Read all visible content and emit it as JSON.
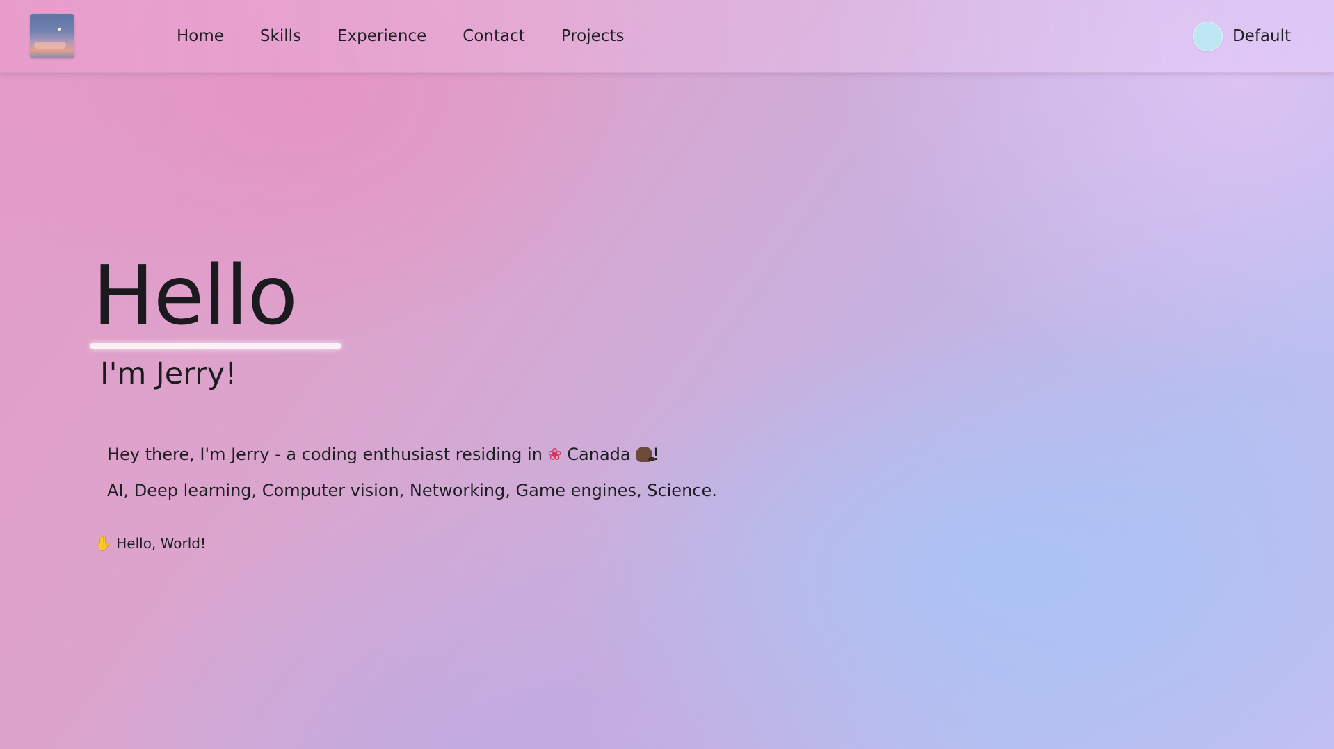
{
  "navbar": {
    "logo_icon": "sunset-sky-logo-icon",
    "links": [
      {
        "label": "Home"
      },
      {
        "label": "Skills"
      },
      {
        "label": "Experience"
      },
      {
        "label": "Contact"
      },
      {
        "label": "Projects"
      }
    ],
    "theme": {
      "label": "Default",
      "swatch_color": "#bfe6f3",
      "icon": "theme-swatch-icon"
    }
  },
  "hero": {
    "title": "Hello",
    "subtitle": "I'm Jerry!",
    "intro_line_1_prefix": "Hey there, I'm Jerry - a coding enthusiast residing in ",
    "intro_line_1_icon_flag": "maple-leaf-icon",
    "intro_line_1_country": "Canada",
    "intro_line_1_icon_animal": "beaver-icon",
    "intro_line_1_suffix": "!",
    "intro_line_2": "AI, Deep learning, Computer vision, Networking, Game engines, Science.",
    "greeting_icon": "waving-hand-icon",
    "greeting": "Hello, World!"
  },
  "colors": {
    "text": "#1e1e24",
    "underline": "#ffffff",
    "gradient_pink": "#e49ac8",
    "gradient_blue": "#b8bff0"
  }
}
